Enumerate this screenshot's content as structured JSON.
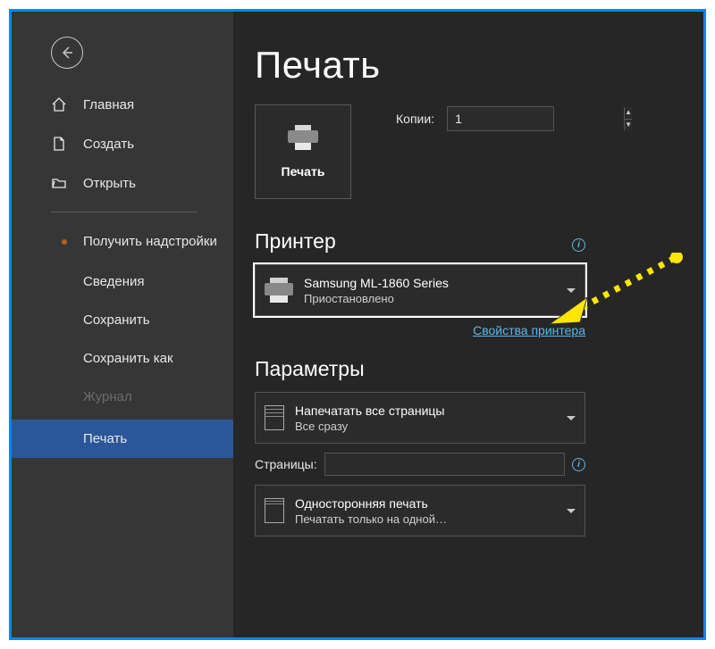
{
  "sidebar": {
    "items": [
      {
        "label": "Главная",
        "icon": "home-icon"
      },
      {
        "label": "Создать",
        "icon": "new-doc-icon"
      },
      {
        "label": "Открыть",
        "icon": "folder-open-icon"
      }
    ],
    "addins": "Получить надстройки",
    "info": "Сведения",
    "save": "Сохранить",
    "saveAs": "Сохранить как",
    "history": "Журнал",
    "print": "Печать"
  },
  "main": {
    "title": "Печать",
    "printBtn": "Печать",
    "copiesLabel": "Копии:",
    "copiesValue": "1",
    "printerSection": "Принтер",
    "printerName": "Samsung ML-1860 Series",
    "printerStatus": "Приостановлено",
    "printerPropsLink": "Свойства принтера",
    "paramsSection": "Параметры",
    "printRange": {
      "line1": "Напечатать все страницы",
      "line2": "Все сразу"
    },
    "pagesLabel": "Страницы:",
    "duplex": {
      "line1": "Односторонняя печать",
      "line2": "Печатать только на одной…"
    }
  }
}
